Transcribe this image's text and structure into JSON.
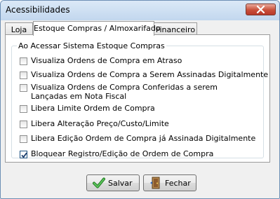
{
  "window": {
    "title": "Acessibilidades",
    "close_icon": "close-icon"
  },
  "tabs": [
    {
      "label": "Loja",
      "active": false
    },
    {
      "label": "Estoque Compras / Almoxarifado",
      "active": true
    },
    {
      "label": "Financeiro",
      "active": false
    }
  ],
  "group": {
    "legend": "Ao Acessar Sistema Estoque Compras",
    "options": [
      {
        "label": "Visualiza Ordens de Compra em Atraso",
        "checked": false
      },
      {
        "label": "Visualiza Ordens de Compra a Serem Assinadas Digitalmente",
        "checked": false
      },
      {
        "label": "Visualiza Ordens de Compra Conferidas a serem Lançadas em Nota Fiscal",
        "checked": false
      },
      {
        "label": "Libera Limite Ordem de Compra",
        "checked": false
      },
      {
        "label": "Libera Alteração Preço/Custo/Limite",
        "checked": false
      },
      {
        "label": "Libera Edição Ordem de Compra já Assinada Digitalmente",
        "checked": false
      },
      {
        "label": "Bloquear Registro/Edição de Ordem de Compra",
        "checked": true
      }
    ]
  },
  "buttons": {
    "save": {
      "label": "Salvar",
      "icon": "checkmark-icon",
      "icon_color": "#2e9a2e"
    },
    "close": {
      "label": "Fechar",
      "icon": "door-exit-icon"
    }
  }
}
